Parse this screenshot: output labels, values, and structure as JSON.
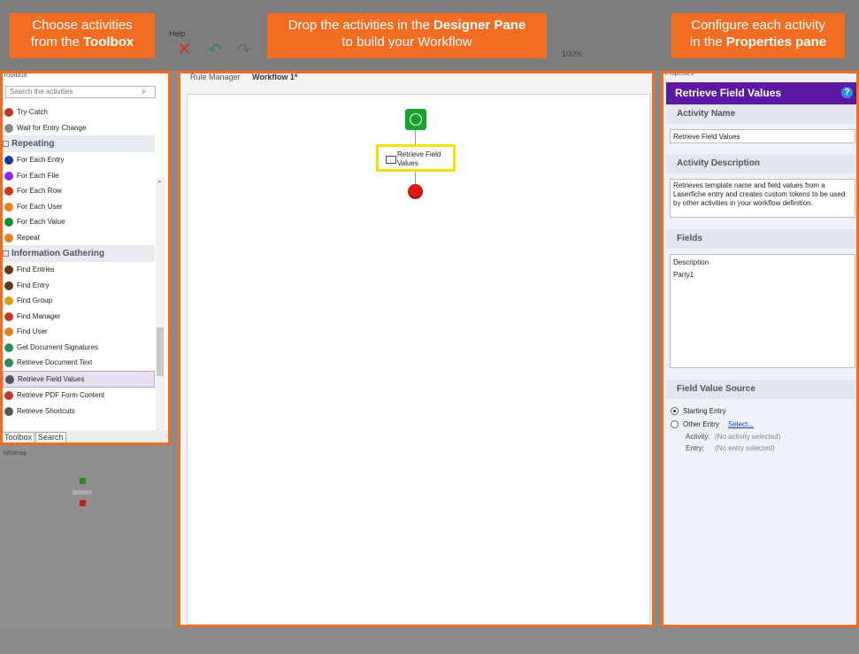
{
  "menu": {
    "help": "Help",
    "zoom": "100%"
  },
  "callouts": {
    "toolbox": {
      "line1": "Choose activities",
      "line2_prefix": "from the ",
      "line2_bold": "Toolbox"
    },
    "designer": {
      "line1_prefix": "Drop the activities in the ",
      "line1_bold": "Designer Pane",
      "line2": "to build your Workflow"
    },
    "properties": {
      "line1": "Configure each activity",
      "line2_prefix": "in the ",
      "line2_bold": "Properties pane"
    }
  },
  "toolbox": {
    "title": "Toolbox",
    "search_placeholder": "Search the activities",
    "items": [
      {
        "label": "Try-Catch",
        "kind": "item",
        "icon": "try-catch-icon",
        "color": "#c0392b"
      },
      {
        "label": "Wait for Entry Change",
        "kind": "item",
        "icon": "wait-icon",
        "color": "#888888"
      },
      {
        "label": "Repeating",
        "kind": "category"
      },
      {
        "label": "For Each Entry",
        "kind": "item",
        "icon": "loop-icon",
        "color": "#1a3a8a"
      },
      {
        "label": "For Each File",
        "kind": "item",
        "icon": "loop-icon",
        "color": "#8a2be2"
      },
      {
        "label": "For Each Row",
        "kind": "item",
        "icon": "loop-icon",
        "color": "#d2321e"
      },
      {
        "label": "For Each User",
        "kind": "item",
        "icon": "loop-icon",
        "color": "#e67e22"
      },
      {
        "label": "For Each Value",
        "kind": "item",
        "icon": "loop-icon",
        "color": "#1a8a3a"
      },
      {
        "label": "Repeat",
        "kind": "item",
        "icon": "loop-icon",
        "color": "#e67e22"
      },
      {
        "label": "Information Gathering",
        "kind": "category"
      },
      {
        "label": "Find Entries",
        "kind": "item",
        "icon": "binoculars-icon",
        "color": "#5a3a1a"
      },
      {
        "label": "Find Entry",
        "kind": "item",
        "icon": "binoculars-icon",
        "color": "#5a3a1a"
      },
      {
        "label": "Find Group",
        "kind": "item",
        "icon": "group-icon",
        "color": "#d4a017"
      },
      {
        "label": "Find Manager",
        "kind": "item",
        "icon": "manager-icon",
        "color": "#c0392b"
      },
      {
        "label": "Find User",
        "kind": "item",
        "icon": "user-icon",
        "color": "#e67e22"
      },
      {
        "label": "Get Document Signatures",
        "kind": "item",
        "icon": "signature-icon",
        "color": "#2e8b57"
      },
      {
        "label": "Retrieve Document Text",
        "kind": "item",
        "icon": "document-text-icon",
        "color": "#2e8b57"
      },
      {
        "label": "Retrieve Field Values",
        "kind": "item",
        "icon": "field-values-icon",
        "color": "#555555",
        "selected": true
      },
      {
        "label": "Retrieve PDF Form Content",
        "kind": "item",
        "icon": "pdf-icon",
        "color": "#c0392b"
      },
      {
        "label": "Retrieve Shortcuts",
        "kind": "item",
        "icon": "shortcut-icon",
        "color": "#555555"
      }
    ],
    "tabs": [
      "Toolbox",
      "Search"
    ]
  },
  "minimap": {
    "title": "Minimap"
  },
  "designer": {
    "tabs": [
      "Rule Manager",
      "Workflow 1*"
    ],
    "activity_label": "Retrieve Field Values"
  },
  "properties": {
    "title": "Properties",
    "header": "Retrieve Field Values",
    "activity_name_label": "Activity Name",
    "activity_name_value": "Retrieve Field Values",
    "activity_description_label": "Activity Description",
    "activity_description_value": "Retrieves template name and field values from a Laserfiche entry and creates custom tokens to be used by other activities in your workflow definition.",
    "fields_label": "Fields",
    "fields": [
      "Description",
      "Party1"
    ],
    "source_label": "Field Value Source",
    "source_options": [
      "Starting Entry",
      "Other Entry"
    ],
    "select_link": "Select...",
    "activity_key": "Activity:",
    "activity_val": "(No activity selected)",
    "entry_key": "Entry:",
    "entry_val": "(No entry selected)"
  },
  "colors": {
    "accent": "#f26d21",
    "props_header": "#5b18a3",
    "highlight": "#f2e000"
  }
}
